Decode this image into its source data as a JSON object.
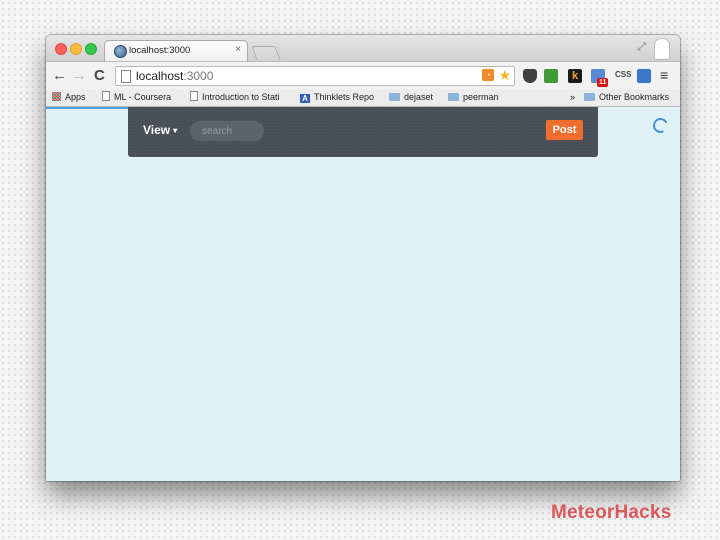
{
  "browser": {
    "tab": {
      "title": "localhost:3000",
      "close": "×"
    },
    "url": {
      "host": "localhost",
      "port": ":3000"
    },
    "nav": {
      "back": "←",
      "forward": "→",
      "reload": "C"
    },
    "extensions": {
      "mail_badge": "11",
      "css_label": "CSS",
      "menu": "≡",
      "k_label": "k"
    },
    "bookmarks": {
      "apps": "Apps",
      "items": [
        "ML - Coursera",
        "Introduction to Stati",
        "Thinklets Repo",
        "dejaset",
        "peerman"
      ],
      "overflow": "»",
      "other": "Other Bookmarks"
    }
  },
  "app": {
    "nav": {
      "view_label": "View",
      "caret": "▾",
      "search_placeholder": "search",
      "post_label": "Post"
    },
    "colors": {
      "navbar": "#4a4f57",
      "post_button": "#ef6e2e",
      "page_background": "#e1f1f8",
      "loader": "#4c9ed9"
    }
  },
  "watermark": "MeteorHacks"
}
